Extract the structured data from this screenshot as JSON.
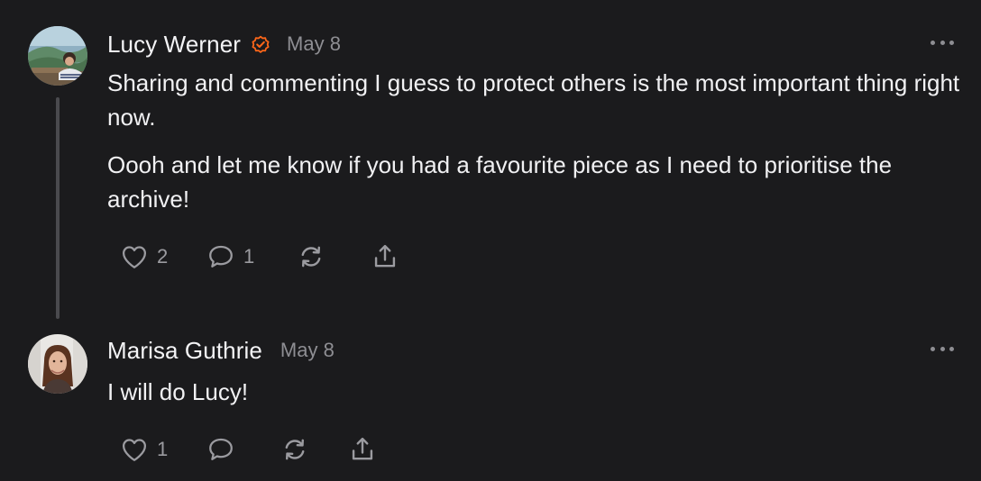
{
  "comments": [
    {
      "author": "Lucy Werner",
      "verified": true,
      "date": "May 8",
      "paragraphs": [
        "Sharing and commenting I guess to protect others is the most important thing right now.",
        "Oooh and let me know if you had a favourite piece as I need to prioritise the archive!"
      ],
      "likes": "2",
      "replies": "1"
    },
    {
      "author": "Marisa Guthrie",
      "verified": false,
      "date": "May 8",
      "paragraphs": [
        "I will do Lucy!"
      ],
      "likes": "1",
      "replies": ""
    }
  ],
  "icons": {
    "like": "heart-icon",
    "reply": "speech-bubble-icon",
    "restack": "restack-arrows-icon",
    "share": "share-upload-icon",
    "more": "more-horizontal-icon",
    "verified": "verified-badge-icon"
  },
  "colors": {
    "background": "#1b1b1d",
    "text": "#f1f1f3",
    "muted": "#8e8e93",
    "verified": "#ff6719",
    "thread_line": "#4a4a4e"
  }
}
